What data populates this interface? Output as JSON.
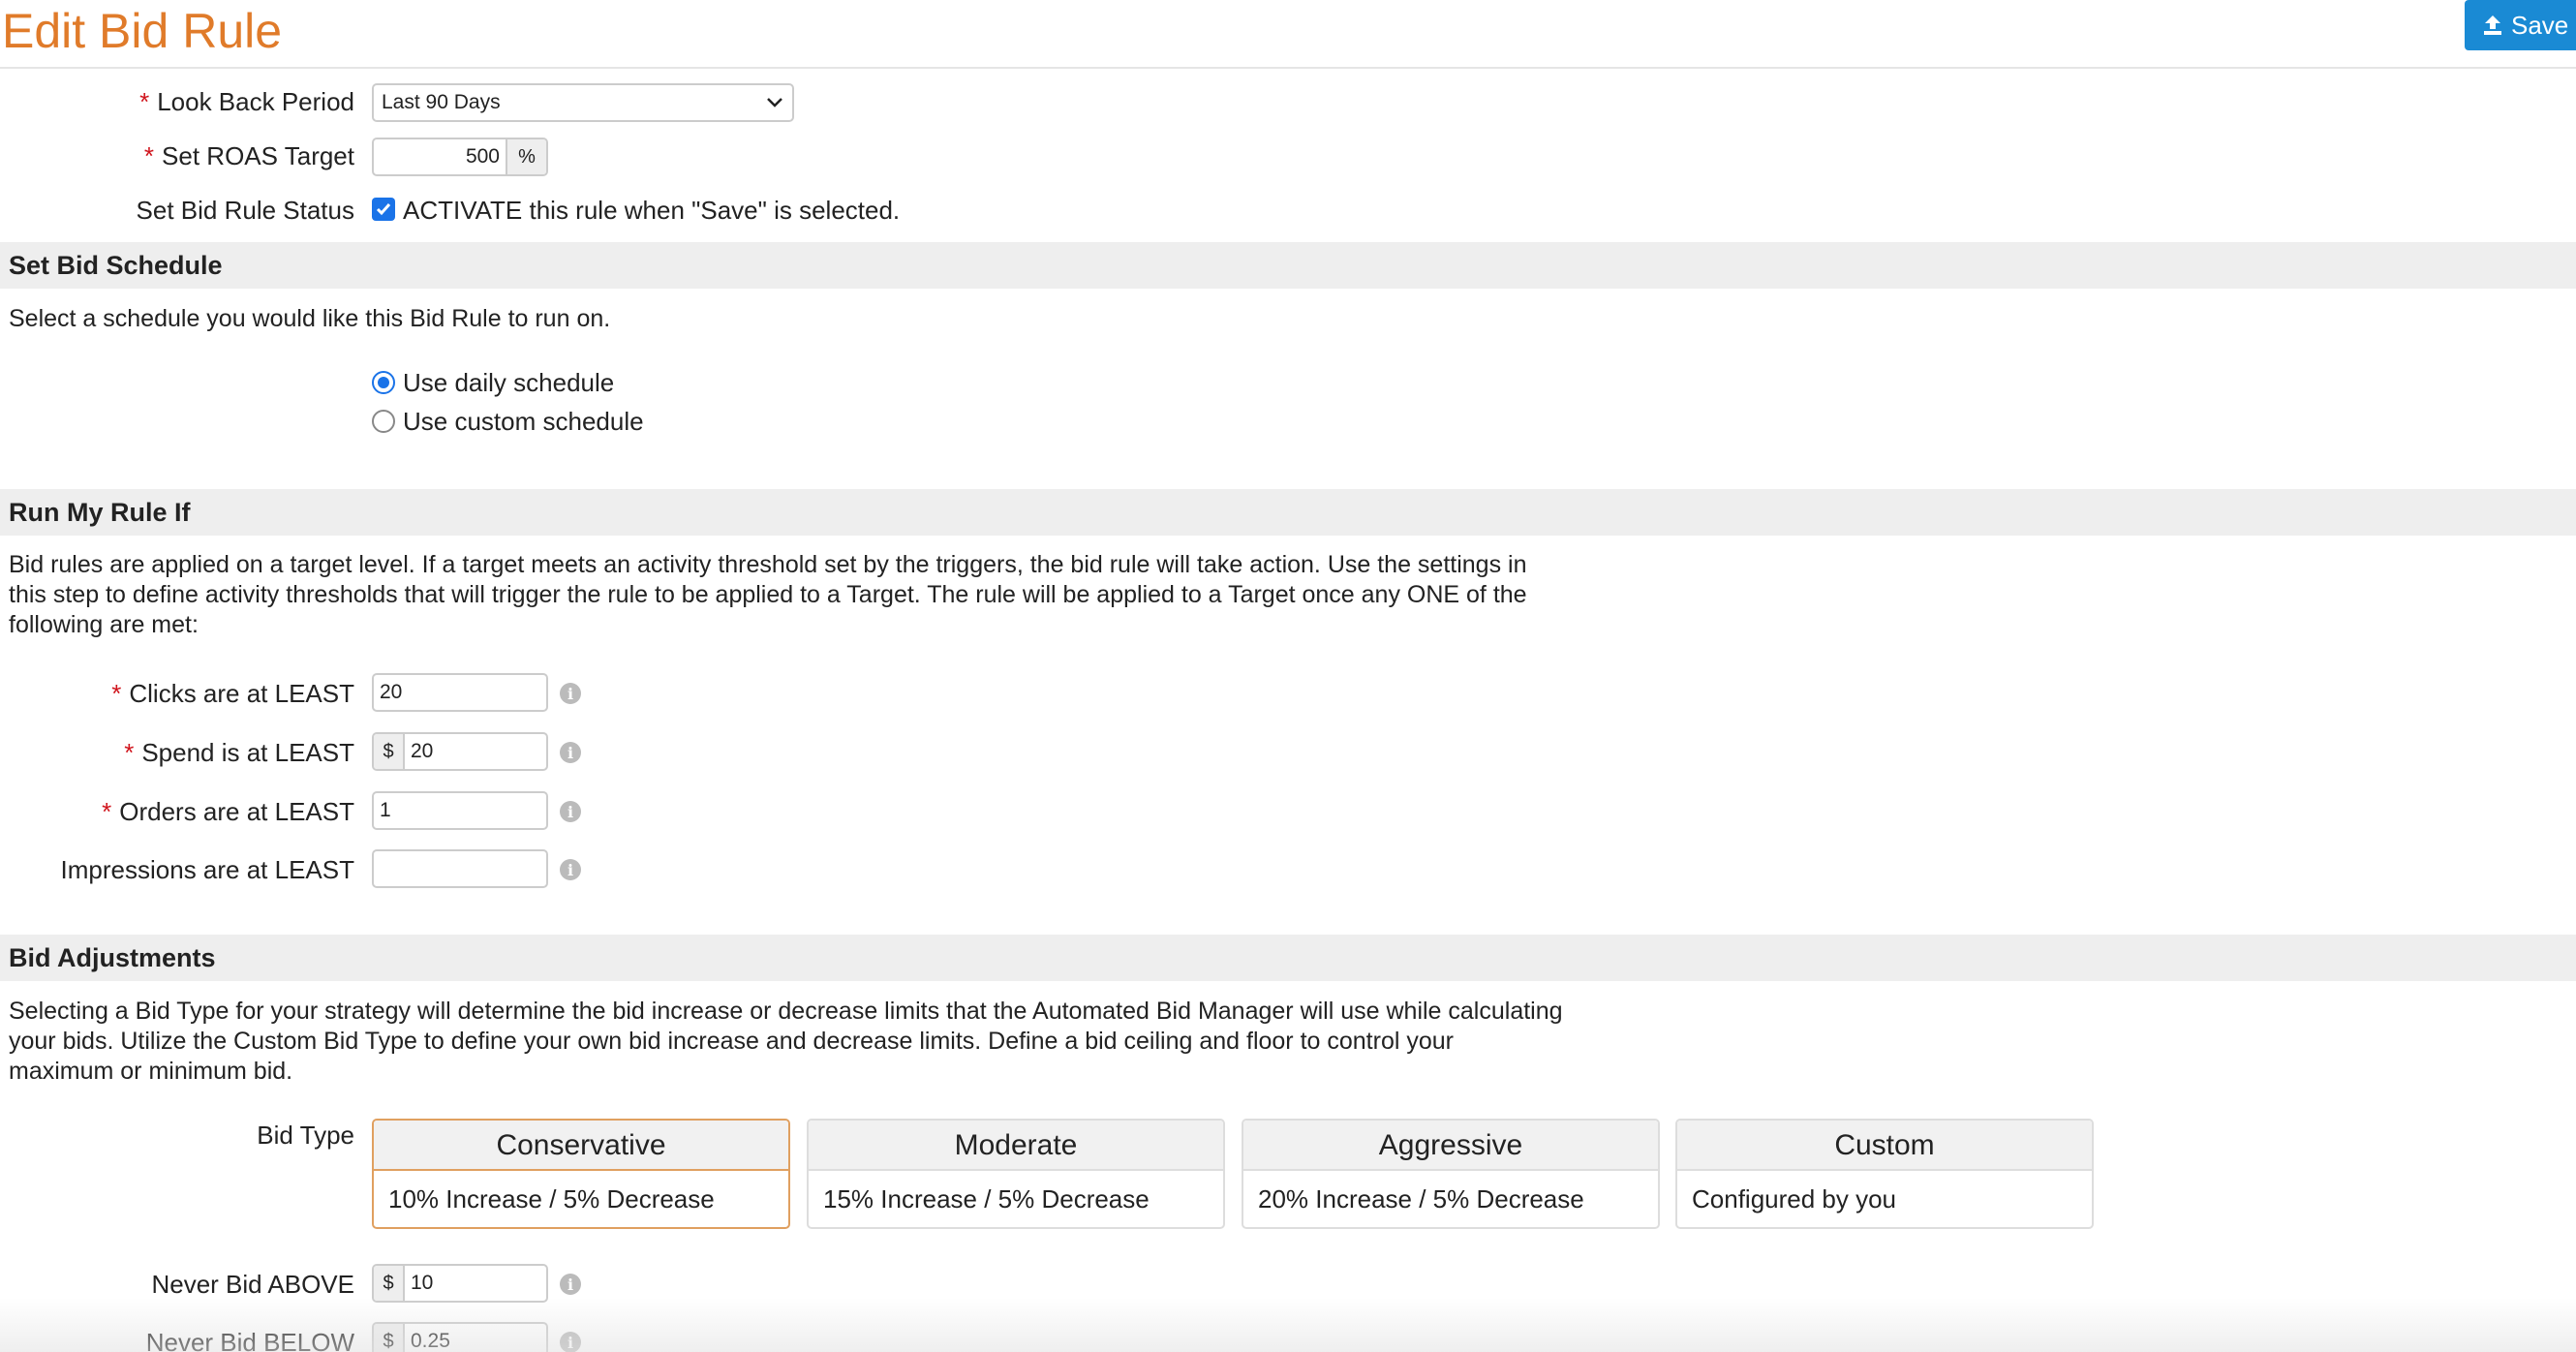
{
  "header": {
    "title": "Edit Bid Rule",
    "save_label": "Save"
  },
  "settings": {
    "lookback": {
      "label": "Look Back Period",
      "value": "Last 90 Days"
    },
    "roas": {
      "label": "Set ROAS Target",
      "value": "500",
      "unit": "%"
    },
    "status": {
      "label": "Set Bid Rule Status",
      "checkbox_label": "ACTIVATE this rule when \"Save\" is selected.",
      "checked": true
    }
  },
  "schedule": {
    "title": "Set Bid Schedule",
    "description": "Select a schedule you would like this Bid Rule to run on.",
    "options": [
      {
        "label": "Use daily schedule",
        "selected": true
      },
      {
        "label": "Use custom schedule",
        "selected": false
      }
    ]
  },
  "triggers": {
    "title": "Run My Rule If",
    "description_lines": [
      "Bid rules are applied on a target level. If a target meets an activity threshold set by the triggers, the bid rule will take action. Use the settings in",
      "this step to define activity thresholds that will trigger the rule to be applied to a Target. The rule will be applied to a Target once any ONE of the",
      "following are met:"
    ],
    "fields": [
      {
        "label": "Clicks are at LEAST",
        "required": true,
        "prefix": "",
        "value": "20"
      },
      {
        "label": "Spend is at LEAST",
        "required": true,
        "prefix": "$",
        "value": "20"
      },
      {
        "label": "Orders are at LEAST",
        "required": true,
        "prefix": "",
        "value": "1"
      },
      {
        "label": "Impressions are at LEAST",
        "required": false,
        "prefix": "",
        "value": ""
      }
    ]
  },
  "adjustments": {
    "title": "Bid Adjustments",
    "description_lines": [
      "Selecting a Bid Type for your strategy will determine the bid increase or decrease limits that the Automated Bid Manager will use while calculating",
      "your bids. Utilize the Custom Bid Type to define your own bid increase and decrease limits. Define a bid ceiling and floor to control your",
      "maximum or minimum bid."
    ],
    "bid_type_label": "Bid Type",
    "bid_types": [
      {
        "name": "Conservative",
        "detail": "10% Increase / 5% Decrease",
        "selected": true
      },
      {
        "name": "Moderate",
        "detail": "15% Increase / 5% Decrease",
        "selected": false
      },
      {
        "name": "Aggressive",
        "detail": "20% Increase / 5% Decrease",
        "selected": false
      },
      {
        "name": "Custom",
        "detail": "Configured by you",
        "selected": false
      }
    ],
    "ceiling": {
      "label": "Never Bid ABOVE",
      "prefix": "$",
      "value": "10"
    },
    "floor": {
      "label": "Never Bid BELOW",
      "prefix": "$",
      "value": "0.25"
    }
  },
  "colors": {
    "title_orange": "#e07b2a",
    "save_blue": "#1a8ad4",
    "required_red": "#d0141c",
    "section_bg": "#eeeeee",
    "selected_border": "#e0a060"
  },
  "icons": {
    "save": "upload-icon",
    "info": "info-icon",
    "select": "chevron-down-icon"
  }
}
